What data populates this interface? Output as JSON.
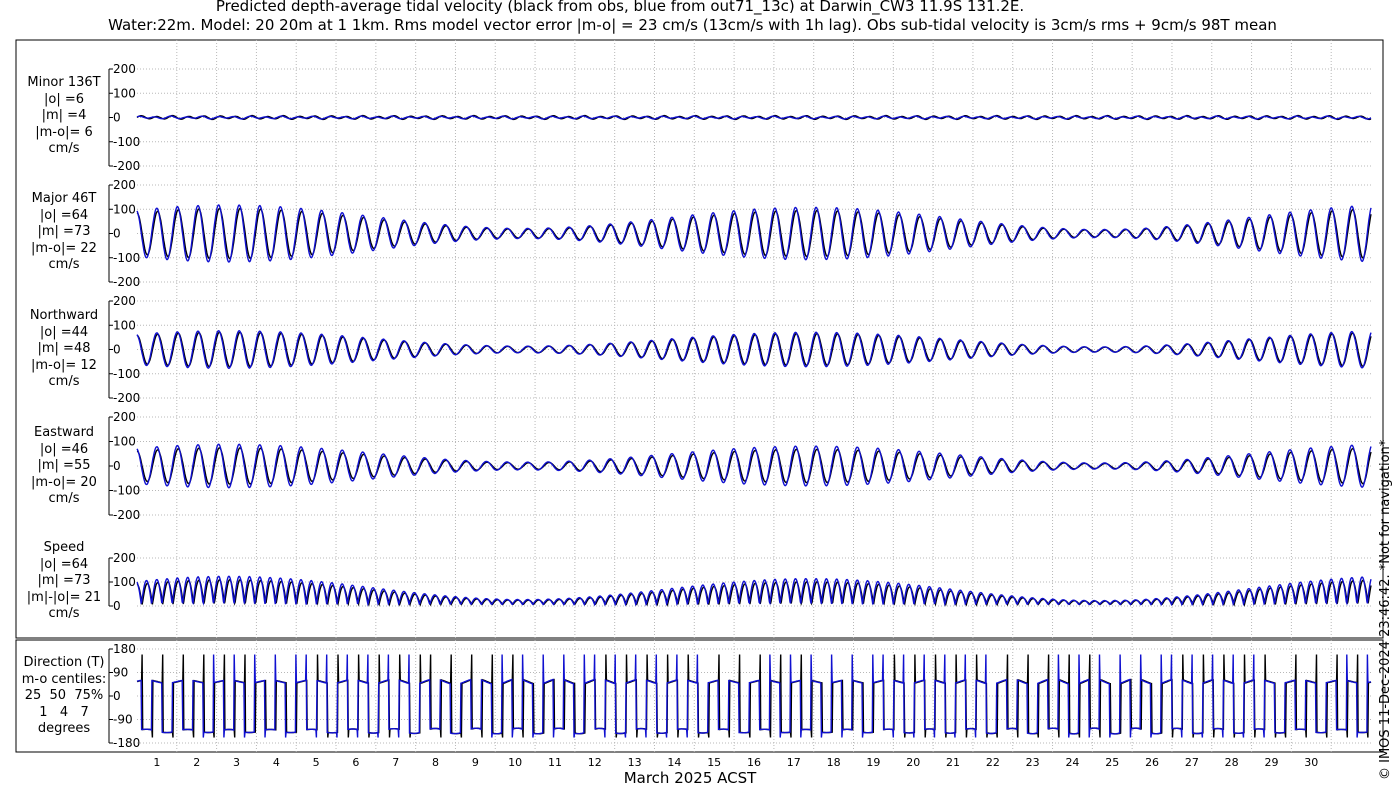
{
  "header": {
    "title_line1": "Predicted depth-average tidal velocity (black from obs, blue from out71_13c) at Darwin_CW3 11.9S 131.2E.",
    "title_line2": "Water:22m. Model: 20 20m at 1 1km. Rms model vector error |m-o| = 23 cm/s (13cm/s with 1h lag). Obs sub-tidal velocity is 3cm/s rms + 9cm/s 98T mean"
  },
  "footer": {
    "xlabel": "March 2025 ACST",
    "credit": "© IMOS 11-Dec-2024 23:46:42. *Not for navigation*"
  },
  "chart_data": {
    "type": "line",
    "x_axis": {
      "label": "March 2025 ACST",
      "range_days": [
        0,
        31
      ],
      "ticks": [
        "1",
        "2",
        "3",
        "4",
        "5",
        "6",
        "7",
        "8",
        "9",
        "10",
        "11",
        "12",
        "13",
        "14",
        "15",
        "16",
        "17",
        "18",
        "19",
        "20",
        "21",
        "22",
        "23",
        "24",
        "25",
        "26",
        "27",
        "28",
        "29",
        "30"
      ]
    },
    "colors": {
      "obs": "#000000",
      "model": "#1010d0"
    },
    "grid": true,
    "panels": [
      {
        "label_lines": [
          "Minor 136T",
          "|o| =6",
          "|m| =4",
          "|m-o|= 6",
          "cm/s"
        ],
        "yticks": [
          "200",
          "100",
          "0",
          "-100",
          "-200"
        ],
        "ylim": [
          -200,
          200
        ],
        "obs_amplitude": 6,
        "model_amplitude": 4
      },
      {
        "label_lines": [
          "Major 46T",
          "|o| =64",
          "|m| =73",
          "|m-o|= 22",
          "cm/s"
        ],
        "yticks": [
          "200",
          "100",
          "0",
          "-100",
          "-200"
        ],
        "ylim": [
          -200,
          200
        ],
        "obs_amplitude": 64,
        "model_amplitude": 73
      },
      {
        "label_lines": [
          "Northward",
          "|o| =44",
          "|m| =48",
          "|m-o|= 12",
          "cm/s"
        ],
        "yticks": [
          "200",
          "100",
          "0",
          "-100",
          "-200"
        ],
        "ylim": [
          -200,
          200
        ],
        "obs_amplitude": 44,
        "model_amplitude": 48
      },
      {
        "label_lines": [
          "Eastward",
          "|o| =46",
          "|m| =55",
          "|m-o|= 20",
          "cm/s"
        ],
        "yticks": [
          "200",
          "100",
          "0",
          "-100",
          "-200"
        ],
        "ylim": [
          -200,
          200
        ],
        "obs_amplitude": 46,
        "model_amplitude": 55
      },
      {
        "label_lines": [
          "Speed",
          "|o| =64",
          "|m| =73",
          "|m|-|o|= 21",
          "cm/s"
        ],
        "yticks": [
          "200",
          "100",
          "0"
        ],
        "ylim": [
          0,
          200
        ],
        "obs_amplitude": 64,
        "model_amplitude": 73
      },
      {
        "label_lines": [
          "Direction (T)",
          "m-o centiles:",
          "25  50  75%",
          "1   4   7",
          "degrees"
        ],
        "yticks": [
          "180",
          "90",
          "0",
          "-90",
          "-180"
        ],
        "ylim": [
          -180,
          180
        ],
        "direction_centiles": [
          1,
          4,
          7
        ]
      }
    ]
  }
}
